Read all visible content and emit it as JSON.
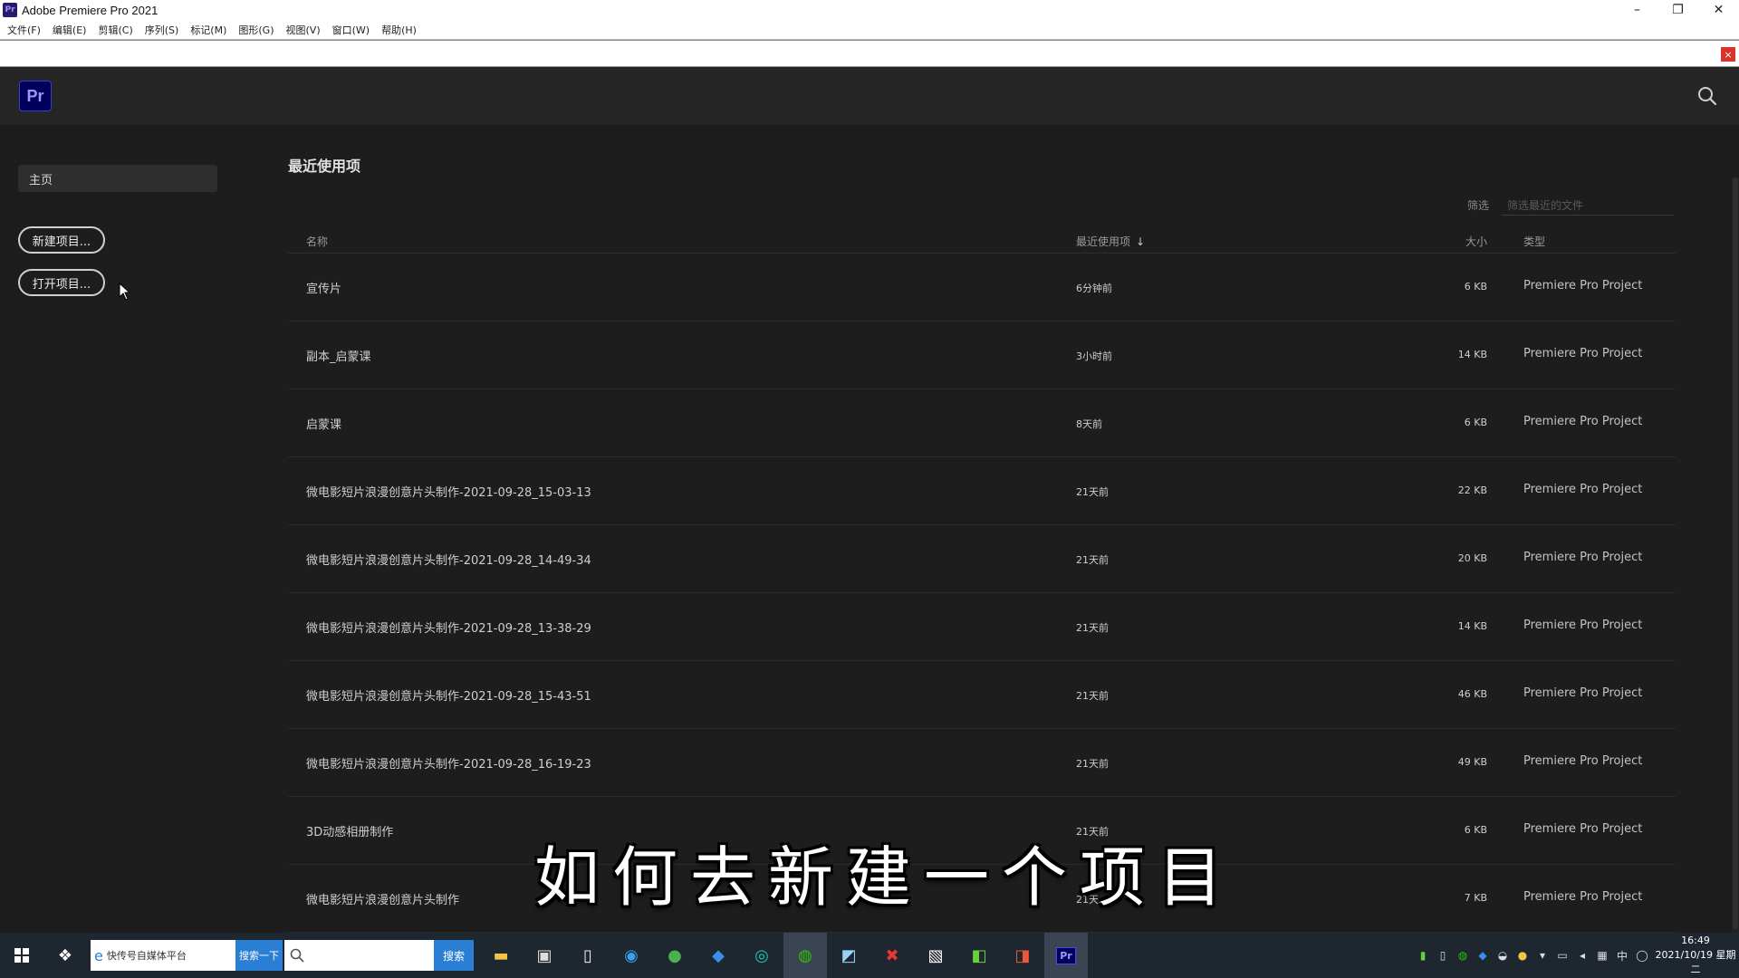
{
  "window": {
    "title": "Adobe Premiere Pro 2021",
    "app_icon_text": "Pr",
    "controls": [
      "–",
      "❐",
      "✕"
    ]
  },
  "menu": [
    "文件(F)",
    "编辑(E)",
    "剪辑(C)",
    "序列(S)",
    "标记(M)",
    "图形(G)",
    "视图(V)",
    "窗口(W)",
    "帮助(H)"
  ],
  "notice": {
    "close": "×"
  },
  "header": {
    "logo": "Pr"
  },
  "sidebar": {
    "home": "主页",
    "new_project": "新建项目...",
    "open_project": "打开项目..."
  },
  "recent": {
    "title": "最近使用项",
    "filter_label": "筛选",
    "filter_placeholder": "筛选最近的文件",
    "columns": {
      "name": "名称",
      "date": "最近使用项",
      "size": "大小",
      "type": "类型"
    },
    "sort_arrow": "↓",
    "rows": [
      {
        "name": "宣传片",
        "date": "6分钟前",
        "size": "6 KB",
        "type": "Premiere Pro Project"
      },
      {
        "name": "副本_启蒙课",
        "date": "3小时前",
        "size": "14 KB",
        "type": "Premiere Pro Project"
      },
      {
        "name": "启蒙课",
        "date": "8天前",
        "size": "6 KB",
        "type": "Premiere Pro Project"
      },
      {
        "name": "微电影短片浪漫创意片头制作-2021-09-28_15-03-13",
        "date": "21天前",
        "size": "22 KB",
        "type": "Premiere Pro Project"
      },
      {
        "name": "微电影短片浪漫创意片头制作-2021-09-28_14-49-34",
        "date": "21天前",
        "size": "20 KB",
        "type": "Premiere Pro Project"
      },
      {
        "name": "微电影短片浪漫创意片头制作-2021-09-28_13-38-29",
        "date": "21天前",
        "size": "14 KB",
        "type": "Premiere Pro Project"
      },
      {
        "name": "微电影短片浪漫创意片头制作-2021-09-28_15-43-51",
        "date": "21天前",
        "size": "46 KB",
        "type": "Premiere Pro Project"
      },
      {
        "name": "微电影短片浪漫创意片头制作-2021-09-28_16-19-23",
        "date": "21天前",
        "size": "49 KB",
        "type": "Premiere Pro Project"
      },
      {
        "name": "3D动感相册制作",
        "date": "21天前",
        "size": "6 KB",
        "type": "Premiere Pro Project"
      },
      {
        "name": "微电影短片浪漫创意片头制作",
        "date": "21天...",
        "size": "7 KB",
        "type": "Premiere Pro Project"
      }
    ]
  },
  "subtitle": "如何去新建一个项目",
  "taskbar": {
    "ie_text": "快传号自媒体平台",
    "ie_button": "搜索一下",
    "search_button": "搜索",
    "ime": "中",
    "time": "16:49",
    "date": "2021/10/19 星期二"
  },
  "colors": {
    "accent_blue": "#2a7fd4",
    "pr_logo_bg": "#00005b",
    "pr_logo_text": "#9999ff",
    "panel_bg": "#1d1d1d"
  }
}
